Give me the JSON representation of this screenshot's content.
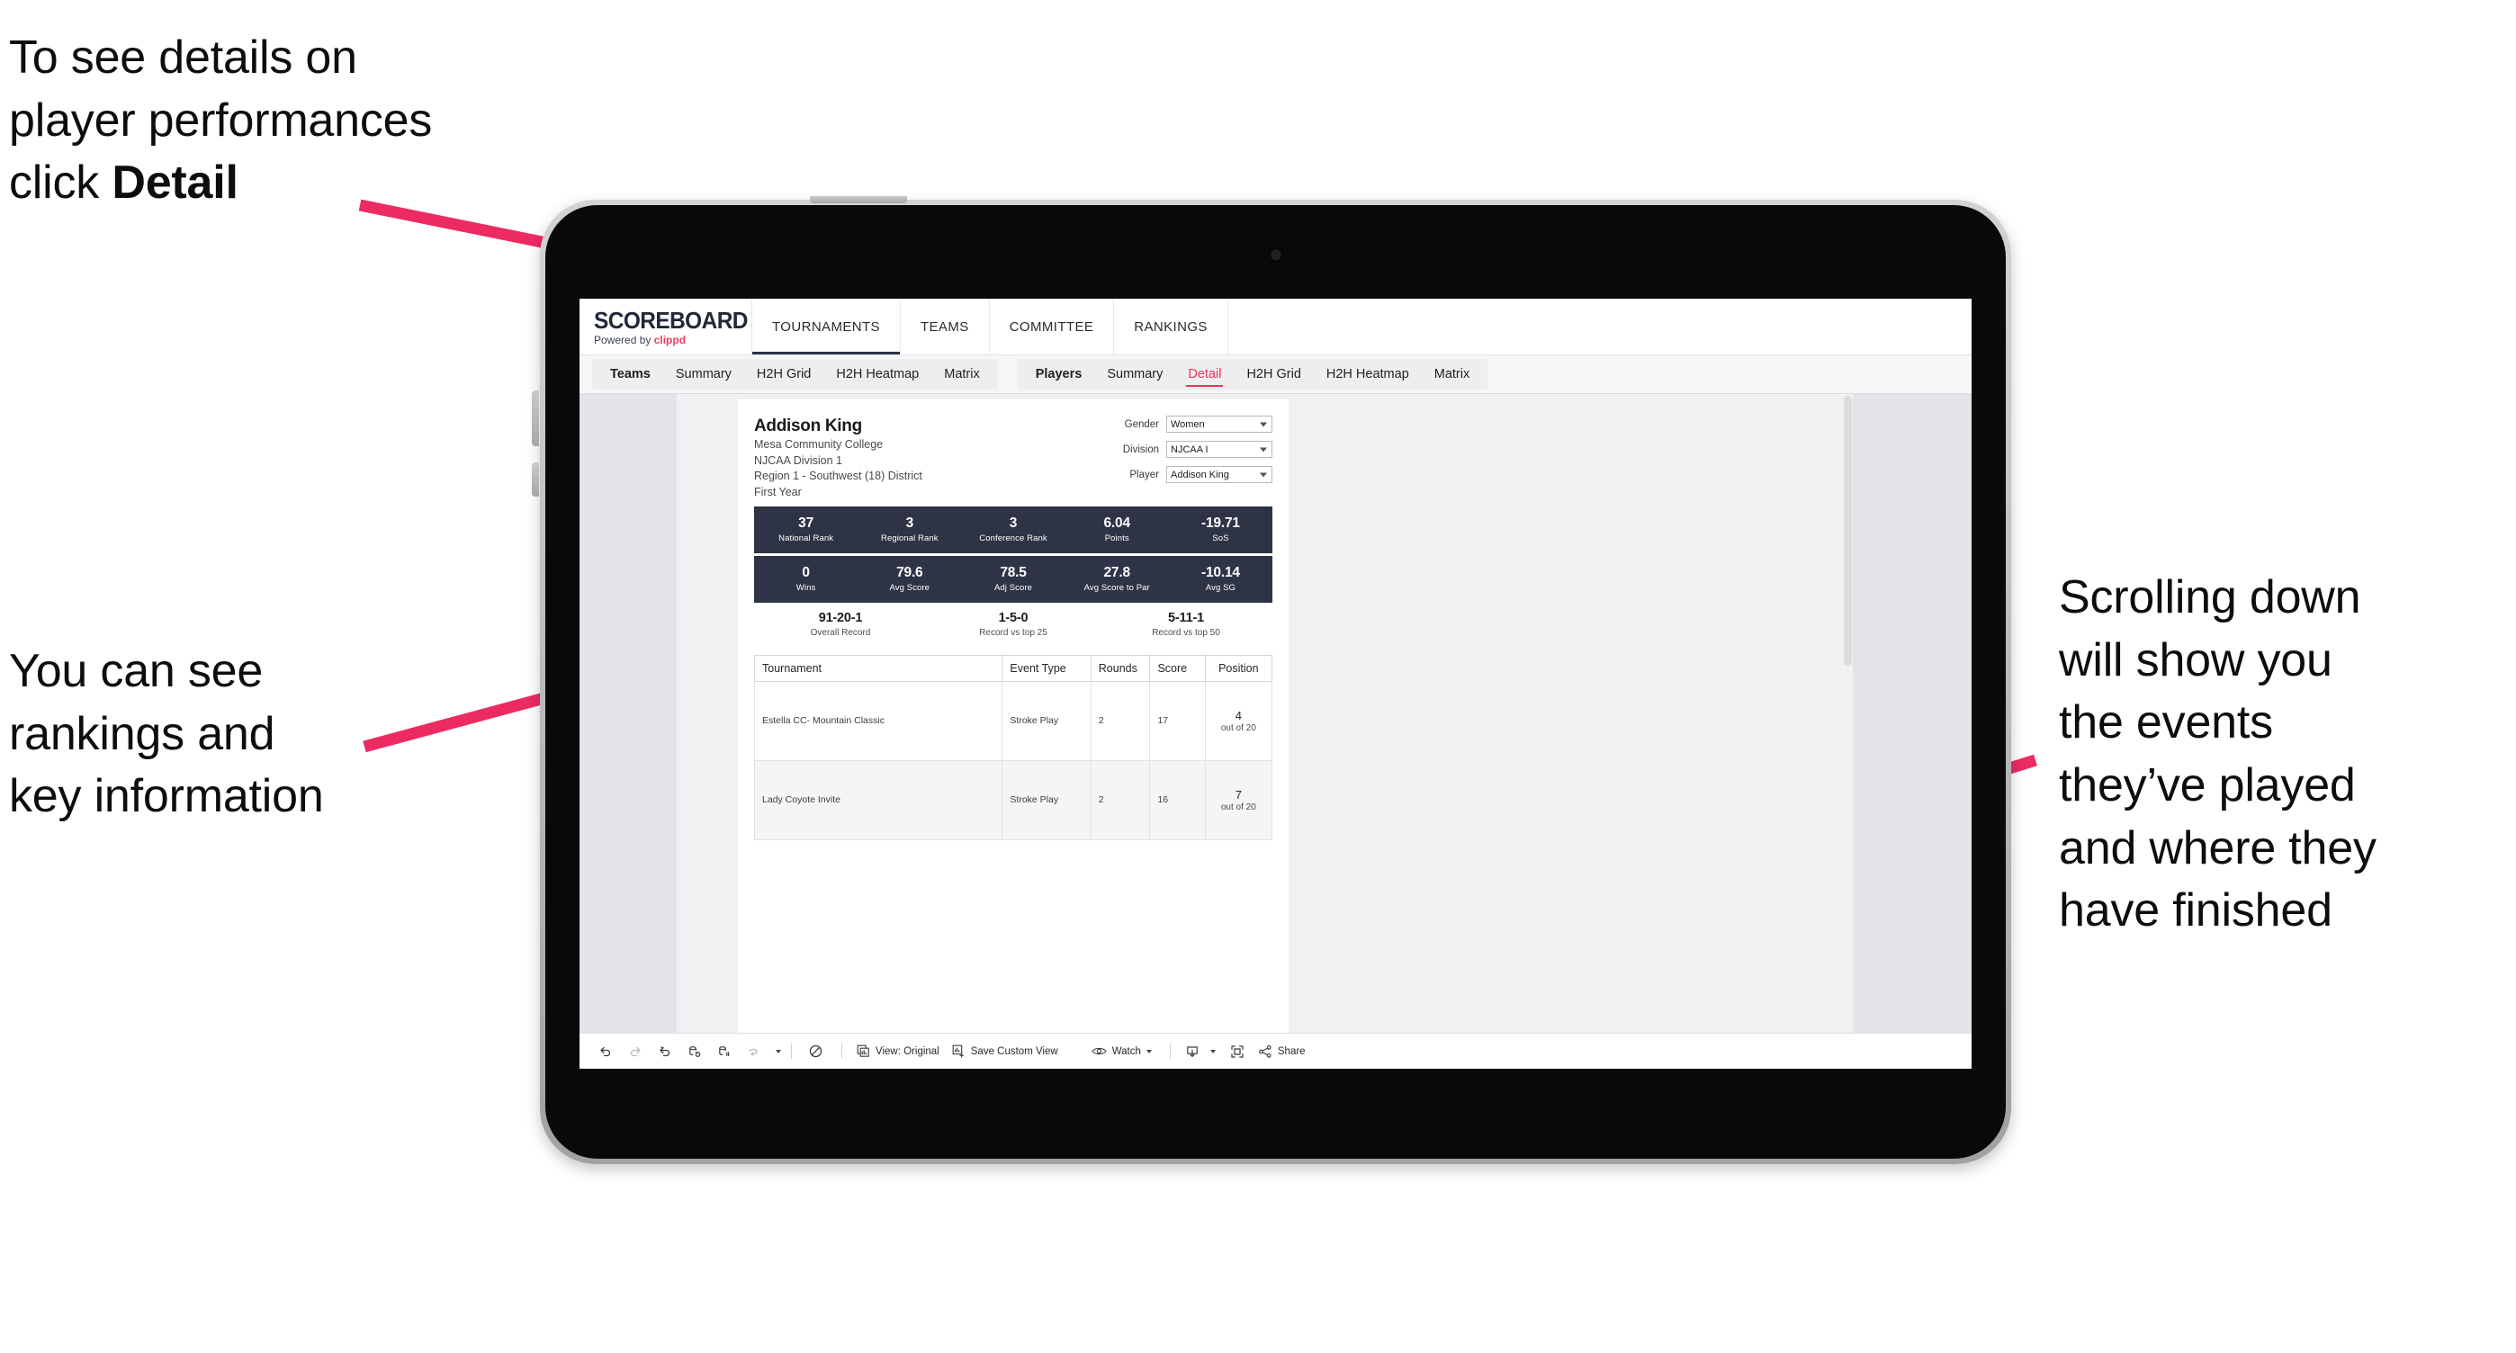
{
  "annotations": {
    "top_left": "To see details on\nplayer performances\nclick ",
    "top_left_bold": "Detail",
    "mid_left": "You can see\nrankings and\nkey information",
    "right": "Scrolling down\nwill show you\nthe events\nthey’ve played\nand where they\nhave finished",
    "arrow_color": "#ec2b62"
  },
  "app": {
    "logo_word": "SCOREBOARD",
    "logo_powered": "Powered by ",
    "logo_brand": "clippd",
    "top_nav": [
      {
        "label": "TOURNAMENTS"
      },
      {
        "label": "TEAMS"
      },
      {
        "label": "COMMITTEE"
      },
      {
        "label": "RANKINGS"
      }
    ],
    "sub_nav": {
      "teams_group": [
        "Teams",
        "Summary",
        "H2H Grid",
        "H2H Heatmap",
        "Matrix"
      ],
      "players_group": [
        "Players",
        "Summary",
        "Detail",
        "H2H Grid",
        "H2H Heatmap",
        "Matrix"
      ],
      "active": "Detail"
    }
  },
  "player": {
    "name": "Addison King",
    "college": "Mesa Community College",
    "division": "NJCAA Division 1",
    "region": "Region 1 - Southwest (18) District",
    "year": "First Year"
  },
  "controls": [
    {
      "label": "Gender",
      "value": "Women"
    },
    {
      "label": "Division",
      "value": "NJCAA I"
    },
    {
      "label": "Player",
      "value": "Addison King"
    }
  ],
  "stats_row_1": [
    {
      "value": "37",
      "label": "National Rank"
    },
    {
      "value": "3",
      "label": "Regional Rank"
    },
    {
      "value": "3",
      "label": "Conference Rank"
    },
    {
      "value": "6.04",
      "label": "Points"
    },
    {
      "value": "-19.71",
      "label": "SoS"
    }
  ],
  "stats_row_2": [
    {
      "value": "0",
      "label": "Wins"
    },
    {
      "value": "79.6",
      "label": "Avg Score"
    },
    {
      "value": "78.5",
      "label": "Adj Score"
    },
    {
      "value": "27.8",
      "label": "Avg Score to Par"
    },
    {
      "value": "-10.14",
      "label": "Avg SG"
    }
  ],
  "records": [
    {
      "value": "91-20-1",
      "label": "Overall Record"
    },
    {
      "value": "1-5-0",
      "label": "Record vs top 25"
    },
    {
      "value": "5-11-1",
      "label": "Record vs top 50"
    }
  ],
  "tournament_table": {
    "headers": [
      "Tournament",
      "Event Type",
      "Rounds",
      "Score",
      "Position"
    ],
    "rows": [
      {
        "tournament": "Estella CC- Mountain Classic",
        "event_type": "Stroke Play",
        "rounds": "2",
        "score": "17",
        "position": "4",
        "position_sub": "out of 20"
      },
      {
        "tournament": "Lady Coyote Invite",
        "event_type": "Stroke Play",
        "rounds": "2",
        "score": "16",
        "position": "7",
        "position_sub": "out of 20"
      }
    ]
  },
  "toolbar": {
    "view_label": "View: Original",
    "save_label": "Save Custom View",
    "watch_label": "Watch",
    "share_label": "Share"
  },
  "colors": {
    "accent_pink": "#e8365b",
    "stat_bar_navy": "#2e3446",
    "brand_red": "#ef3e63"
  }
}
